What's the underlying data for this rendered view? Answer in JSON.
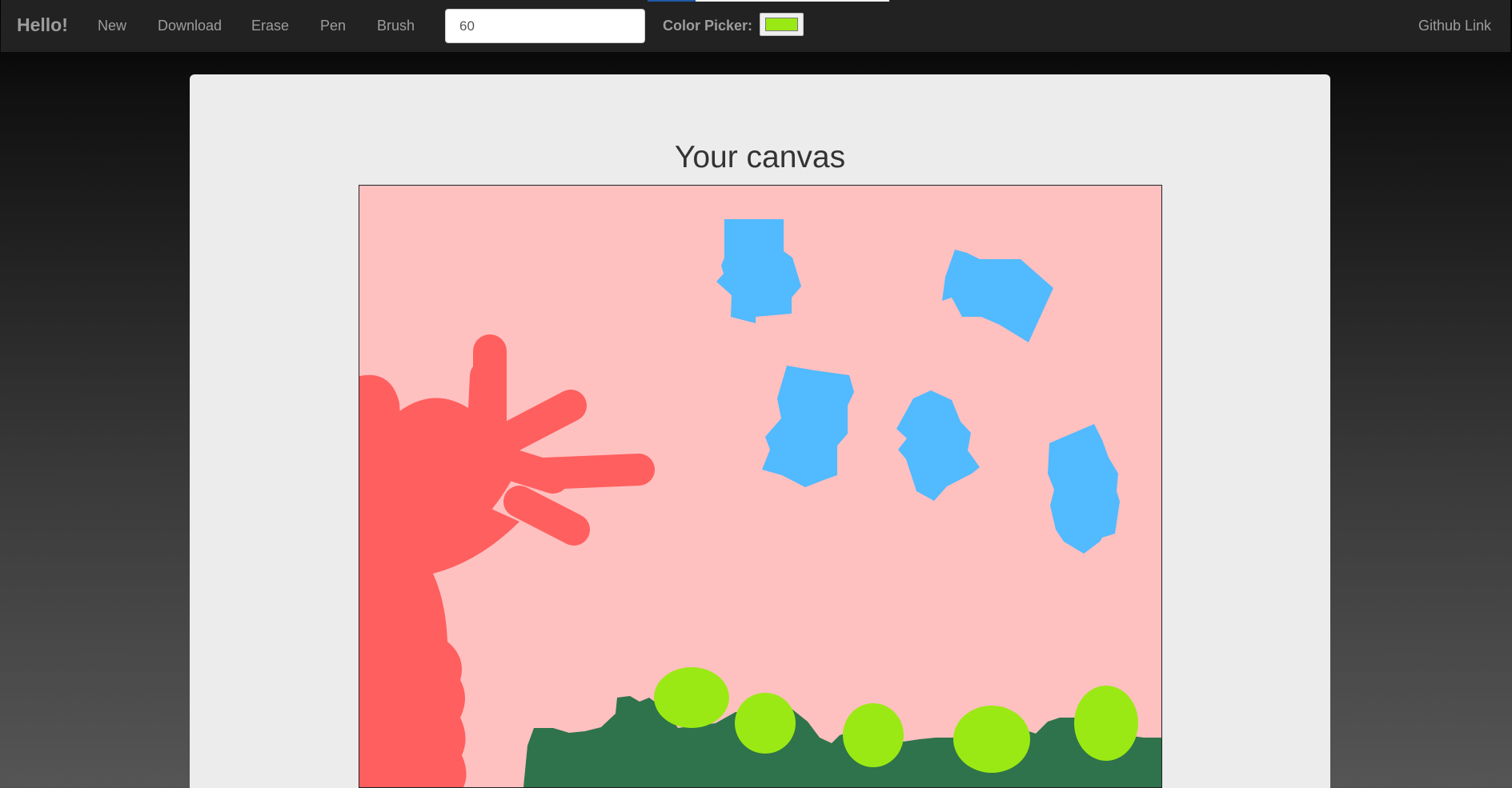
{
  "navbar": {
    "brand": "Hello!",
    "links": {
      "new": "New",
      "download": "Download",
      "erase": "Erase",
      "pen": "Pen",
      "brush": "Brush"
    },
    "size_input_value": "60",
    "color_picker_label": "Color Picker:",
    "color_picker_value": "#9be914",
    "github_link": "Github Link"
  },
  "main": {
    "title": "Your canvas",
    "canvas": {
      "background": "#ffc0c0",
      "colors": {
        "red": "#ff5f5f",
        "blue": "#52baff",
        "dark_green": "#2e734b",
        "lime": "#9be914"
      }
    }
  }
}
